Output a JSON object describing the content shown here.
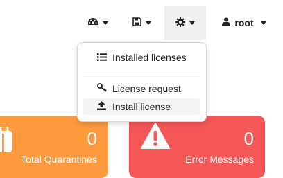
{
  "navbar": {
    "dashboard_icon": "dashboard-icon",
    "save_icon": "floppy-disk-icon",
    "settings_icon": "gear-icon",
    "user_icon": "user-icon",
    "user_label": "root"
  },
  "dropdown": {
    "items": [
      {
        "label": "Installed licenses",
        "icon": "list-icon"
      },
      {
        "label": "License request",
        "icon": "key-icon"
      },
      {
        "label": "Install license",
        "icon": "upload-icon"
      }
    ]
  },
  "cards": [
    {
      "count": "0",
      "label": "Total Quarantines",
      "icon": "briefcase-icon",
      "color": "#fd9a3d"
    },
    {
      "count": "0",
      "label": "Error Messages",
      "icon": "warning-icon",
      "color": "#f55656"
    }
  ]
}
